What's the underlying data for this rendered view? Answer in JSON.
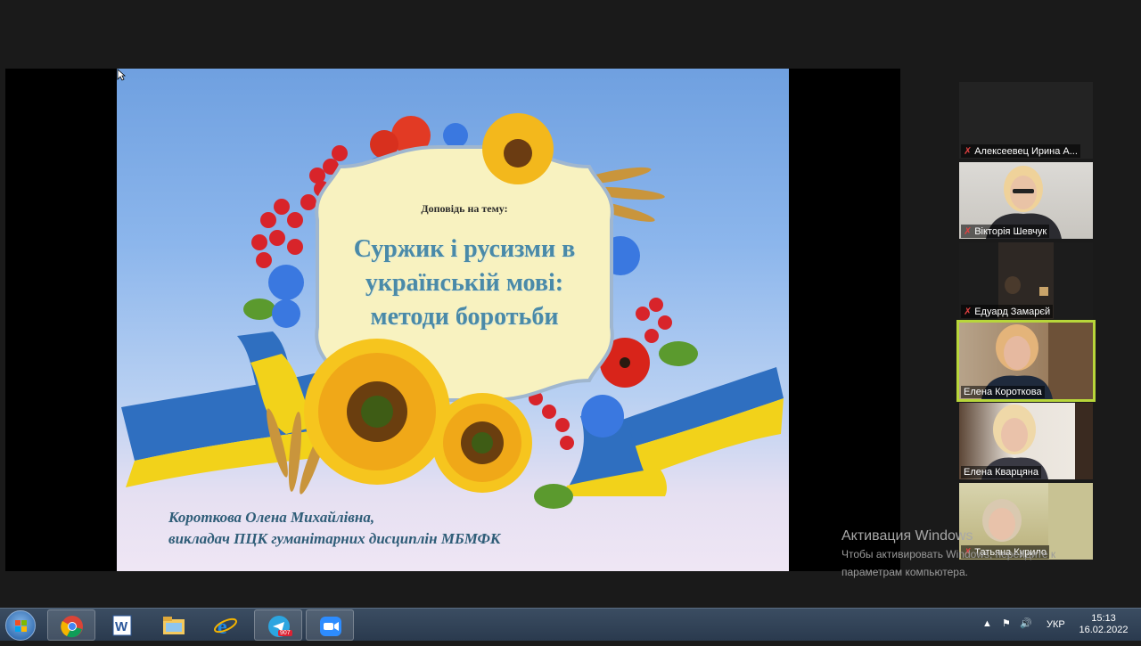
{
  "slide": {
    "subtitle": "Доповідь на тему:",
    "title_lines": [
      "Суржик і русизми в",
      "українській мові:",
      "методи боротьби"
    ],
    "author_lines": [
      "Короткова Олена Михайлівна,",
      "викладач ПЦК гуманітарних дисциплін МБМФК"
    ]
  },
  "participants": [
    {
      "name": "Алексеевец Ирина А...",
      "muted": true,
      "video": false
    },
    {
      "name": "Вікторія Шевчук",
      "muted": true,
      "video": true
    },
    {
      "name": "Едуард Замарєй",
      "muted": true,
      "video": true
    },
    {
      "name": "Елена Короткова",
      "muted": false,
      "video": true,
      "active": true
    },
    {
      "name": "Елена Кварцяна",
      "muted": false,
      "video": true
    },
    {
      "name": "Татьяна Курило",
      "muted": true,
      "video": true
    }
  ],
  "activation": {
    "title": "Активация Windows",
    "line1": "Чтобы активировать Windows, перейдите к",
    "line2": "параметрам компьютера."
  },
  "taskbar": {
    "apps": [
      "chrome-icon",
      "word-icon",
      "file-explorer-icon",
      "internet-explorer-icon",
      "telegram-icon",
      "zoom-icon"
    ],
    "telegram_badge": "907",
    "language": "УКР",
    "time": "15:13",
    "date": "16.02.2022"
  },
  "colors": {
    "flag_blue": "#2f6fc0",
    "flag_yellow": "#f2d21a",
    "active_border": "#b8d63a"
  }
}
